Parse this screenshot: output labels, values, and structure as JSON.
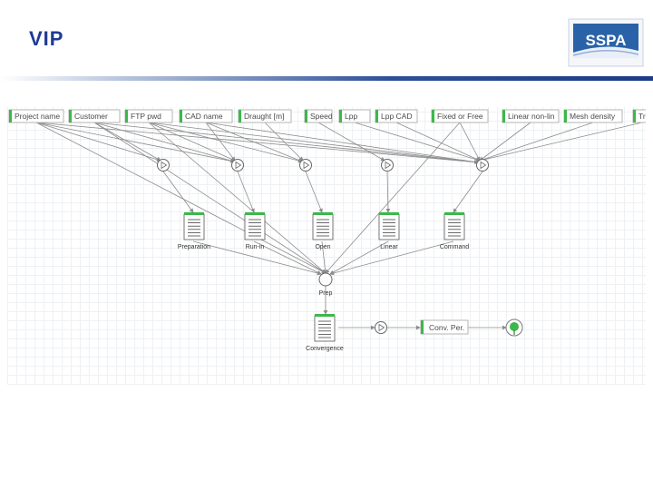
{
  "slide": {
    "title": "VIP"
  },
  "logo": {
    "text": "SSPA",
    "brand_color": "#2a62a8"
  },
  "colors": {
    "accent_green": "#3cb84a",
    "edge_gray": "#8c8c8c",
    "grid": "#eef1f4"
  },
  "inputs": [
    {
      "label": "Project name"
    },
    {
      "label": "Customer"
    },
    {
      "label": "FTP pwd"
    },
    {
      "label": "CAD name"
    },
    {
      "label": "Draught [m]"
    },
    {
      "label": "Speed"
    },
    {
      "label": "Lpp"
    },
    {
      "label": "Lpp CAD"
    },
    {
      "label": "Fixed or Free"
    },
    {
      "label": "Linear non-lin"
    },
    {
      "label": "Mesh density"
    },
    {
      "label": "Tr"
    }
  ],
  "documents": [
    {
      "label": "Preparation"
    },
    {
      "label": "Run-in"
    },
    {
      "label": "Open"
    },
    {
      "label": "Linear"
    },
    {
      "label": "Command"
    }
  ],
  "junction": {
    "label": "Prep"
  },
  "output_doc": {
    "label": "Convergence"
  },
  "result": {
    "label": "Conv. Per."
  }
}
